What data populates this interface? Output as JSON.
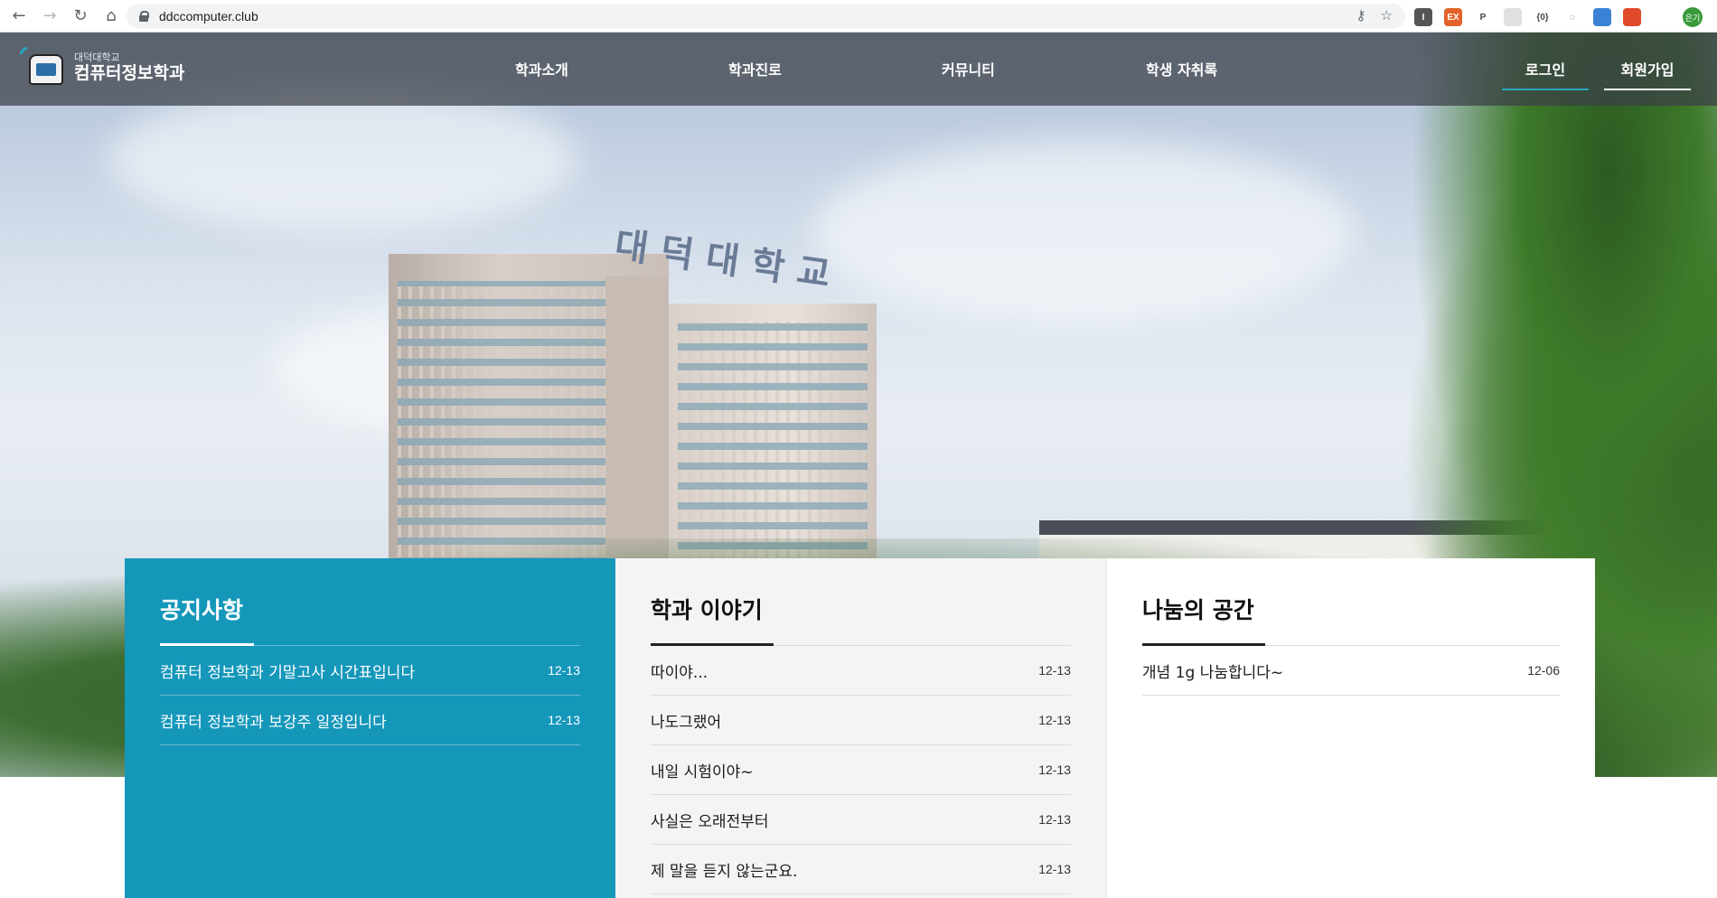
{
  "browser": {
    "url": "ddccomputer.club",
    "extensions": [
      {
        "name": "extension-1-icon",
        "color": "#555555",
        "label": "I"
      },
      {
        "name": "extension-2-icon",
        "color": "#e2622a",
        "label": "EX"
      },
      {
        "name": "extension-3-icon",
        "color": "#ffffff",
        "label": "P"
      },
      {
        "name": "extension-4-icon",
        "color": "#e0e0e0",
        "label": ""
      },
      {
        "name": "extension-5-icon",
        "color": "#ffffff",
        "label": "{0}"
      },
      {
        "name": "extension-6-icon",
        "color": "#ffffff",
        "label": "◌"
      },
      {
        "name": "extension-7-icon",
        "color": "#3b82d6",
        "label": ""
      },
      {
        "name": "extension-8-icon",
        "color": "#e04a2a",
        "label": ""
      },
      {
        "name": "extensions-puzzle-icon",
        "color": "#ffffff",
        "label": ""
      }
    ],
    "profile_label": "은기"
  },
  "site": {
    "logo_small": "대덕대학교",
    "logo_big": "컴퓨터정보학과",
    "nav": [
      "학과소개",
      "학과진로",
      "커뮤니티",
      "학생 자취록"
    ],
    "login": "로그인",
    "signup": "회원가입",
    "sign_text": "대덕대학교"
  },
  "boards": {
    "notice": {
      "title": "공지사항",
      "posts": [
        {
          "title": "컴퓨터 정보학과 기말고사 시간표입니다",
          "date": "12-13"
        },
        {
          "title": "컴퓨터 정보학과 보강주 일정입니다",
          "date": "12-13"
        }
      ]
    },
    "story": {
      "title": "학과 이야기",
      "posts": [
        {
          "title": "따이야...",
          "date": "12-13"
        },
        {
          "title": "나도그랬어",
          "date": "12-13"
        },
        {
          "title": "내일 시험이야~",
          "date": "12-13"
        },
        {
          "title": "사실은 오래전부터",
          "date": "12-13"
        },
        {
          "title": "제 말을 듣지 않는군요.",
          "date": "12-13"
        }
      ]
    },
    "share": {
      "title": "나눔의 공간",
      "posts": [
        {
          "title": "개념 1g 나눔합니다~",
          "date": "12-06"
        }
      ]
    }
  },
  "colors": {
    "notice_bg": "#1597ba",
    "accent": "#2aa5c0",
    "header_overlay": "#3a3e46"
  }
}
